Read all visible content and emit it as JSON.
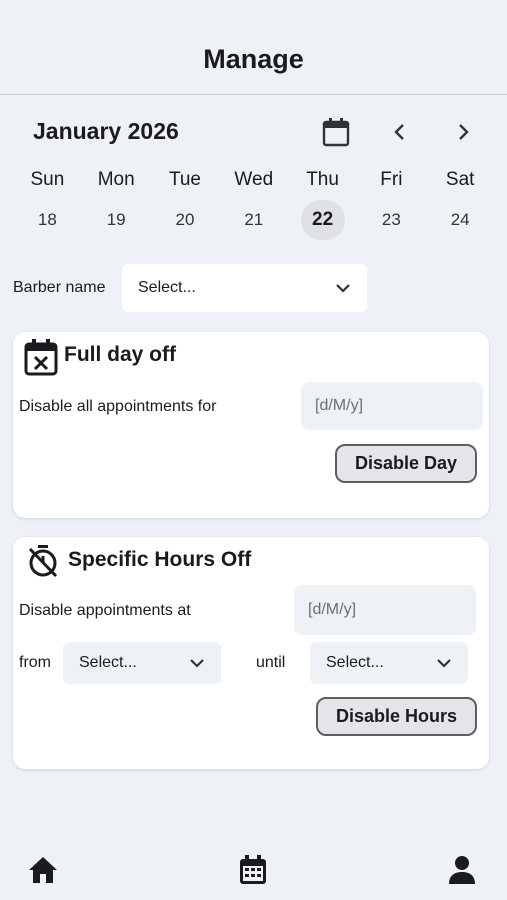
{
  "header": {
    "title": "Manage"
  },
  "calendar": {
    "month_label": "January 2026",
    "days": [
      {
        "name": "Sun",
        "num": "18"
      },
      {
        "name": "Mon",
        "num": "19"
      },
      {
        "name": "Tue",
        "num": "20"
      },
      {
        "name": "Wed",
        "num": "21"
      },
      {
        "name": "Thu",
        "num": "22"
      },
      {
        "name": "Fri",
        "num": "23"
      },
      {
        "name": "Sat",
        "num": "24"
      }
    ],
    "selected_index": 4
  },
  "barber": {
    "label": "Barber name",
    "select_value": "Select..."
  },
  "full_day_off": {
    "title": "Full day off",
    "row_label": "Disable all appointments for",
    "date_placeholder": "[d/M/y]",
    "button_label": "Disable Day"
  },
  "specific_hours_off": {
    "title": "Specific Hours Off",
    "row_label": "Disable appointments at",
    "date_placeholder": "[d/M/y]",
    "from_label": "from",
    "from_value": "Select...",
    "until_label": "until",
    "until_value": "Select...",
    "button_label": "Disable Hours"
  },
  "nav": {
    "items": [
      "home-icon",
      "calendar-grid-icon",
      "person-icon"
    ]
  },
  "colors": {
    "background": "#eef2f7",
    "card": "#ffffff",
    "selected_day": "#dfe1e5",
    "button_border": "#5b5e63"
  }
}
